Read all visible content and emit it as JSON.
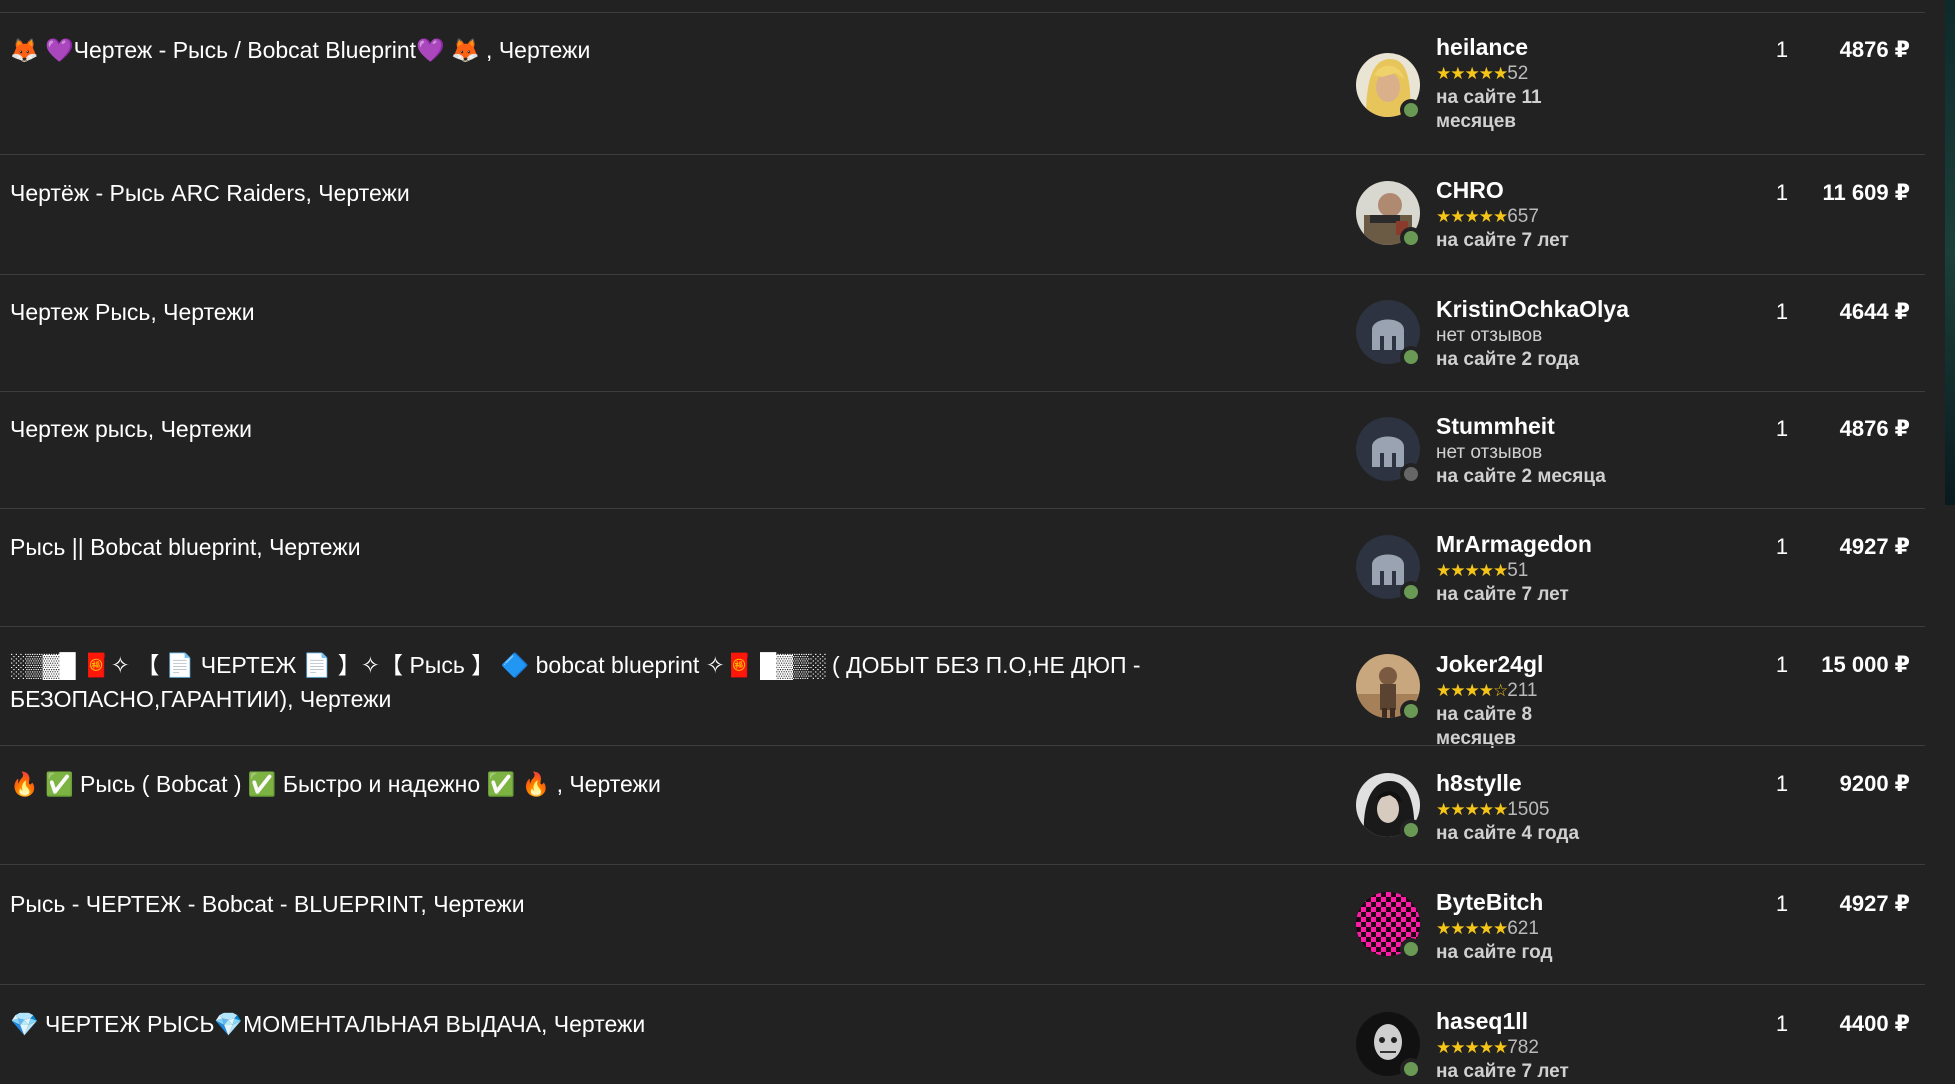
{
  "offers": [
    {
      "title": "🦊 💜Чертеж - Рысь / Bobcat Blueprint💜 🦊 , Чертежи",
      "seller": "heilance",
      "rating_count": "52",
      "stars": 5,
      "since": "на сайте 11 месяцев",
      "qty": "1",
      "price": "4876 ₽",
      "online": true,
      "avatar": "blonde-character"
    },
    {
      "title": "Чертёж - Рысь ARC Raiders, Чертежи",
      "seller": "CHRO",
      "rating_count": "657",
      "stars": 5,
      "since": "на сайте 7 лет",
      "qty": "1",
      "price": "11 609 ₽",
      "online": true,
      "avatar": "soldier-character"
    },
    {
      "title": "Чертеж Рысь, Чертежи",
      "seller": "KristinOchkaOlya",
      "no_reviews": "нет отзывов",
      "since": "на сайте 2 года",
      "qty": "1",
      "price": "4644 ₽",
      "online": true,
      "avatar": "default-helmet"
    },
    {
      "title": "Чертеж рысь, Чертежи",
      "seller": "Stummheit",
      "no_reviews": "нет отзывов",
      "since": "на сайте 2 месяца",
      "qty": "1",
      "price": "4876 ₽",
      "online": false,
      "avatar": "default-helmet"
    },
    {
      "title": "Рысь || Bobcat blueprint, Чертежи",
      "seller": "MrArmagedon",
      "rating_count": "51",
      "stars": 5,
      "since": "на сайте 7 лет",
      "qty": "1",
      "price": "4927 ₽",
      "online": true,
      "avatar": "default-helmet"
    },
    {
      "title": "░▒▓█ 🧧✧ 【 📄 ЧЕРТЕЖ 📄 】✧【 Рысь 】 🔷 bobcat blueprint ✧🧧 █▓▒░ ( ДОБЫТ БЕЗ П.О,НЕ ДЮП - БЕЗОПАСНО,ГАРАНТИИ), Чертежи",
      "seller": "Joker24gl",
      "rating_count": "211",
      "stars": 4,
      "since": "на сайте 8 месяцев",
      "qty": "1",
      "price": "15 000 ₽",
      "online": true,
      "avatar": "desert-character"
    },
    {
      "title": "🔥 ✅ Рысь ( Bobcat ) ✅ Быстро и надежно ✅ 🔥 , Чертежи",
      "seller": "h8stylle",
      "rating_count": "1505",
      "stars": 5,
      "since": "на сайте 4 года",
      "qty": "1",
      "price": "9200 ₽",
      "online": true,
      "avatar": "dark-hair-character"
    },
    {
      "title": "Рысь - ЧЕРТЕЖ - Bobcat - BLUEPRINT, Чертежи",
      "seller": "ByteBitch",
      "rating_count": "621",
      "stars": 5,
      "since": "на сайте год",
      "qty": "1",
      "price": "4927 ₽",
      "online": true,
      "avatar": "pink-checker"
    },
    {
      "title": "💎 ЧЕРТЕЖ РЫСЬ💎МОМЕНТАЛЬНАЯ ВЫДАЧА, Чертежи",
      "seller": "haseq1ll",
      "rating_count": "782",
      "stars": 5,
      "since": "на сайте 7 лет",
      "qty": "1",
      "price": "4400 ₽",
      "online": true,
      "avatar": "bald-character"
    }
  ],
  "colors": {
    "background": "#222222",
    "separator": "#3d3d3d",
    "star": "#f5c518",
    "online": "#6a9955",
    "offline": "#666666"
  }
}
